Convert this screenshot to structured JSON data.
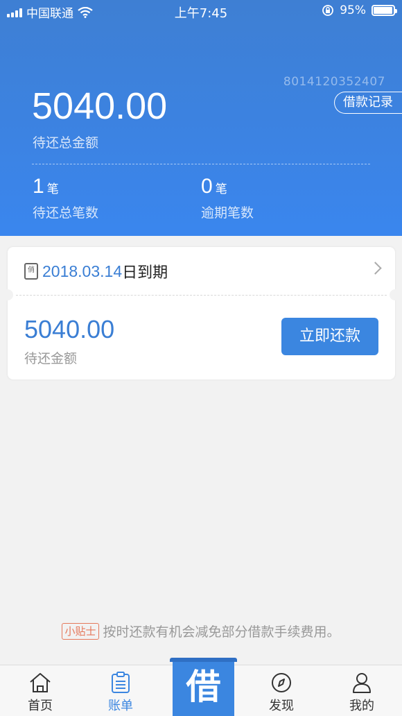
{
  "status_bar": {
    "carrier": "中国联通",
    "time": "上午7:45",
    "battery": "95%"
  },
  "header": {
    "account_no": "8014120352407",
    "record_button": "借款记录",
    "total_amount": "5040.00",
    "total_label": "待还总金额",
    "pending_count": "1",
    "pending_unit": "笔",
    "pending_label": "待还总笔数",
    "overdue_count": "0",
    "overdue_unit": "笔",
    "overdue_label": "逾期笔数"
  },
  "card": {
    "calendar_glyph": "俏",
    "due_date": "2018.03.14",
    "due_suffix": "日到期",
    "amount": "5040.00",
    "amount_label": "待还金额",
    "repay_button": "立即还款"
  },
  "tip": {
    "badge": "小贴士",
    "text": "按时还款有机会减免部分借款手续费用。"
  },
  "tabbar": {
    "home": "首页",
    "bills": "账单",
    "borrow": "借",
    "discover": "发现",
    "mine": "我的"
  },
  "colors": {
    "accent": "#3b86e0",
    "header_top": "#3e7fd3",
    "tip_badge": "#e5785b"
  },
  "icons": [
    "signal-icon",
    "wifi-icon",
    "orientation-lock-icon",
    "battery-icon",
    "calendar-icon",
    "chevron-right-icon",
    "home-icon",
    "bill-icon",
    "compass-icon",
    "user-icon"
  ]
}
